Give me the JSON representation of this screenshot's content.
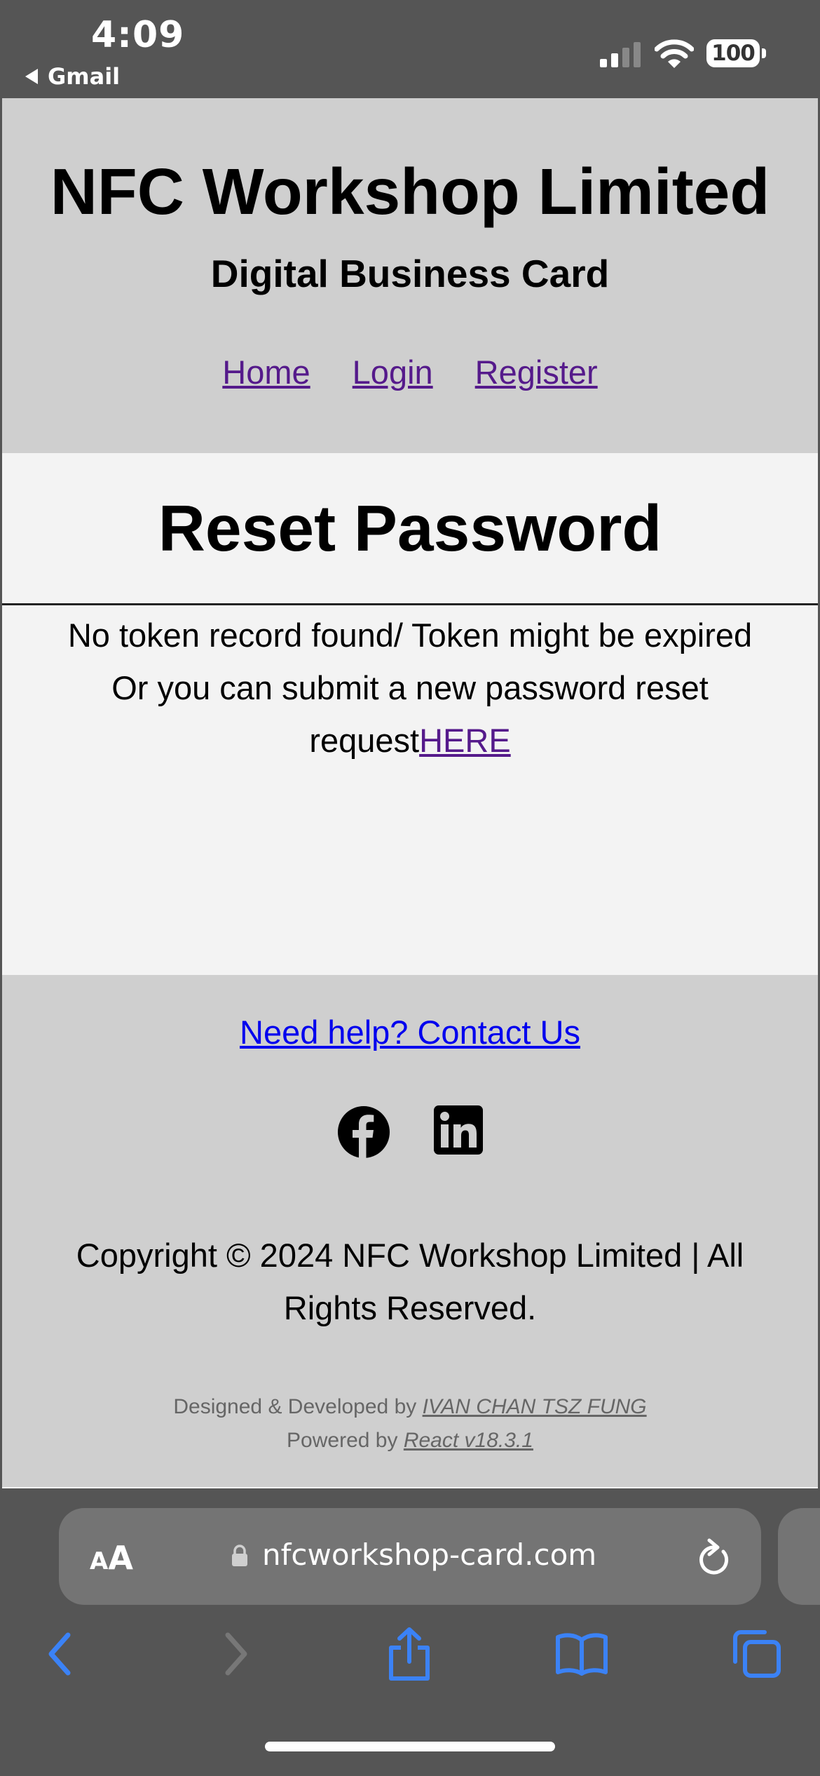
{
  "status_bar": {
    "time": "4:09",
    "back_app": "Gmail",
    "battery": "100",
    "icons": [
      "cellular-signal-icon",
      "wifi-icon",
      "battery-icon"
    ]
  },
  "header": {
    "brand": "NFC Workshop Limited",
    "tagline": "Digital Business Card",
    "nav": [
      {
        "label": "Home"
      },
      {
        "label": "Login"
      },
      {
        "label": "Register"
      }
    ]
  },
  "main": {
    "title": "Reset Password",
    "message_line1": "No token record found/ Token might be expired",
    "message_line2": "Or you can submit a new password reset request",
    "link": "HERE"
  },
  "footer": {
    "contact": "Need help? Contact Us",
    "social": [
      "facebook-icon",
      "linkedin-icon"
    ],
    "copyright": "Copyright © 2024 NFC Workshop Limited | All Rights Reserved.",
    "designed_prefix": "Designed & Developed by ",
    "designer": "IVAN CHAN TSZ FUNG",
    "powered_prefix": "Powered by ",
    "powered_link": "React v18.3.1"
  },
  "browser": {
    "text_size": {
      "small": "A",
      "large": "A"
    },
    "url": "nfcworkshop-card.com",
    "toolbar": [
      "back-icon",
      "forward-icon",
      "share-icon",
      "bookmarks-icon",
      "tabs-icon"
    ]
  },
  "colors": {
    "chrome": "#555555",
    "header_bg": "#cfcfcf",
    "page_bg": "#f3f3f3",
    "visited_link": "#551a8b",
    "link": "#0000ee",
    "toolbar_accent": "#3b82f6"
  }
}
